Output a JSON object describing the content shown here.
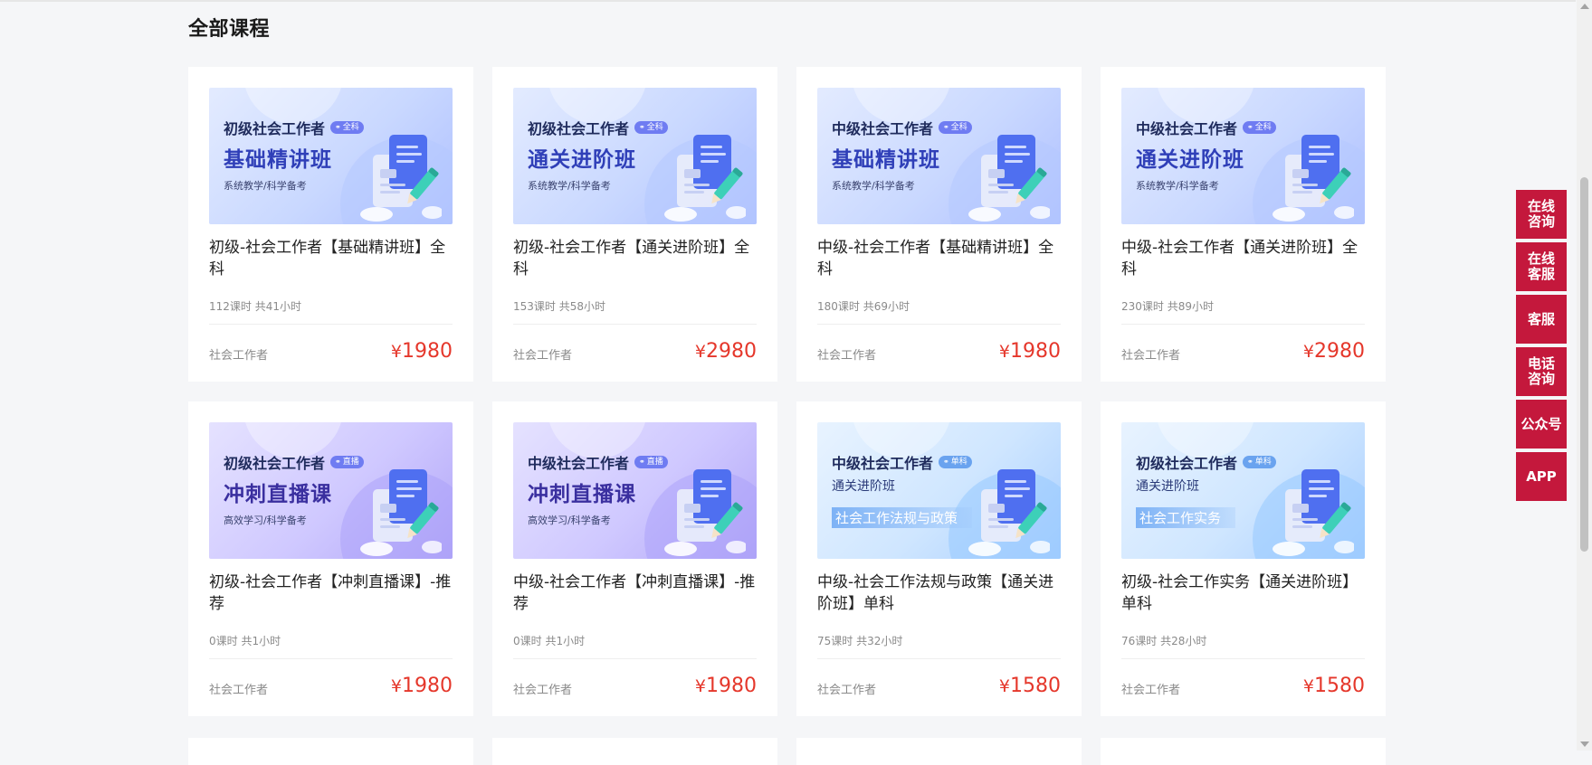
{
  "section": {
    "title": "全部课程"
  },
  "courses": [
    {
      "thumb": {
        "theme": "blue",
        "line1": "初级社会工作者",
        "tag": "全科",
        "big": "基础精讲班",
        "small": "系统教学/科学备考"
      },
      "title": "初级-社会工作者【基础精讲班】全科",
      "meta": "112课时 共41小时",
      "category": "社会工作者",
      "price_symbol": "¥",
      "price": "1980"
    },
    {
      "thumb": {
        "theme": "blue",
        "line1": "初级社会工作者",
        "tag": "全科",
        "big": "通关进阶班",
        "small": "系统教学/科学备考"
      },
      "title": "初级-社会工作者【通关进阶班】全科",
      "meta": "153课时 共58小时",
      "category": "社会工作者",
      "price_symbol": "¥",
      "price": "2980"
    },
    {
      "thumb": {
        "theme": "blue",
        "line1": "中级社会工作者",
        "tag": "全科",
        "big": "基础精讲班",
        "small": "系统教学/科学备考"
      },
      "title": "中级-社会工作者【基础精讲班】全科",
      "meta": "180课时 共69小时",
      "category": "社会工作者",
      "price_symbol": "¥",
      "price": "1980"
    },
    {
      "thumb": {
        "theme": "blue",
        "line1": "中级社会工作者",
        "tag": "全科",
        "big": "通关进阶班",
        "small": "系统教学/科学备考"
      },
      "title": "中级-社会工作者【通关进阶班】全科",
      "meta": "230课时 共89小时",
      "category": "社会工作者",
      "price_symbol": "¥",
      "price": "2980"
    },
    {
      "thumb": {
        "theme": "purple",
        "line1": "初级社会工作者",
        "tag": "直播",
        "big": "冲刺直播课",
        "small": "高效学习/科学备考"
      },
      "title": "初级-社会工作者【冲刺直播课】-推荐",
      "meta": "0课时 共1小时",
      "category": "社会工作者",
      "price_symbol": "¥",
      "price": "1980"
    },
    {
      "thumb": {
        "theme": "purple",
        "line1": "中级社会工作者",
        "tag": "直播",
        "big": "冲刺直播课",
        "small": "高效学习/科学备考"
      },
      "title": "中级-社会工作者【冲刺直播课】-推荐",
      "meta": "0课时 共1小时",
      "category": "社会工作者",
      "price_symbol": "¥",
      "price": "1980"
    },
    {
      "thumb": {
        "theme": "sky",
        "line1": "中级社会工作者",
        "tag": "单科",
        "sub": "通关进阶班",
        "band": "社会工作法规与政策"
      },
      "title": "中级-社会工作法规与政策【通关进阶班】单科",
      "meta": "75课时 共32小时",
      "category": "社会工作者",
      "price_symbol": "¥",
      "price": "1580"
    },
    {
      "thumb": {
        "theme": "sky",
        "line1": "初级社会工作者",
        "tag": "单科",
        "sub": "通关进阶班",
        "band": "社会工作实务"
      },
      "title": "初级-社会工作实务【通关进阶班】单科",
      "meta": "76课时 共28小时",
      "category": "社会工作者",
      "price_symbol": "¥",
      "price": "1580"
    }
  ],
  "sidebar": [
    {
      "label": "在线\n咨询",
      "name": "online-consult-button"
    },
    {
      "label": "在线\n客服",
      "name": "online-service-button"
    },
    {
      "label": "客服",
      "name": "customer-service-button"
    },
    {
      "label": "电话\n咨询",
      "name": "phone-consult-button"
    },
    {
      "label": "公众号",
      "name": "official-account-button"
    },
    {
      "label": "APP",
      "name": "app-button"
    }
  ],
  "colors": {
    "accent": "#c4183c",
    "price": "#e5372b"
  }
}
